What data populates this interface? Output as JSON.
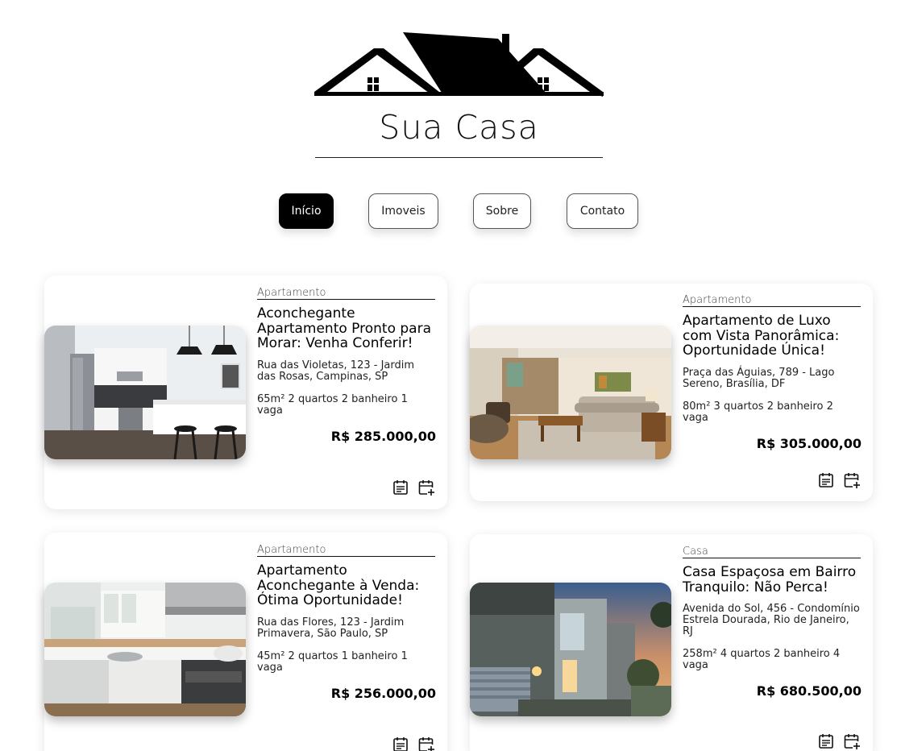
{
  "brand": {
    "name": "Sua Casa"
  },
  "nav": {
    "items": [
      {
        "label": "Início",
        "active": true
      },
      {
        "label": "Imoveis",
        "active": false
      },
      {
        "label": "Sobre",
        "active": false
      },
      {
        "label": "Contato",
        "active": false
      }
    ]
  },
  "listings": [
    {
      "type": "Apartamento",
      "title": "Aconchegante Apartamento Pronto para Morar: Venha Conferir!",
      "address": "Rua das Violetas, 123 - Jardim das Rosas, Campinas, SP",
      "specs": "65m² 2 quartos 2 banheiro 1 vaga",
      "price": "R$ 285.000,00"
    },
    {
      "type": "Apartamento",
      "title": "Apartamento de Luxo com Vista Panorâmica: Oportunidade Única!",
      "address": "Praça das Águias, 789 - Lago Sereno, Brasília, DF",
      "specs": "80m² 3 quartos 2 banheiro 2 vaga",
      "price": "R$ 305.000,00"
    },
    {
      "type": "Apartamento",
      "title": "Apartamento Aconchegante à Venda: Ótima Oportunidade!",
      "address": "Rua das Flores, 123 - Jardim Primavera, São Paulo, SP",
      "specs": "45m² 2 quartos 1 banheiro 1 vaga",
      "price": "R$ 256.000,00"
    },
    {
      "type": "Casa",
      "title": "Casa Espaçosa em Bairro Tranquilo: Não Perca!",
      "address": "Avenida do Sol, 456 - Condomínio Estrela Dourada, Rio de Janeiro, RJ",
      "specs": "258m² 4 quartos 2 banheiro 4 vaga",
      "price": "R$ 680.500,00"
    }
  ],
  "icons": {
    "details": "calendar-details-icon",
    "schedule": "calendar-add-icon"
  },
  "colors": {
    "accent": "#000000",
    "background": "#ffffff"
  }
}
